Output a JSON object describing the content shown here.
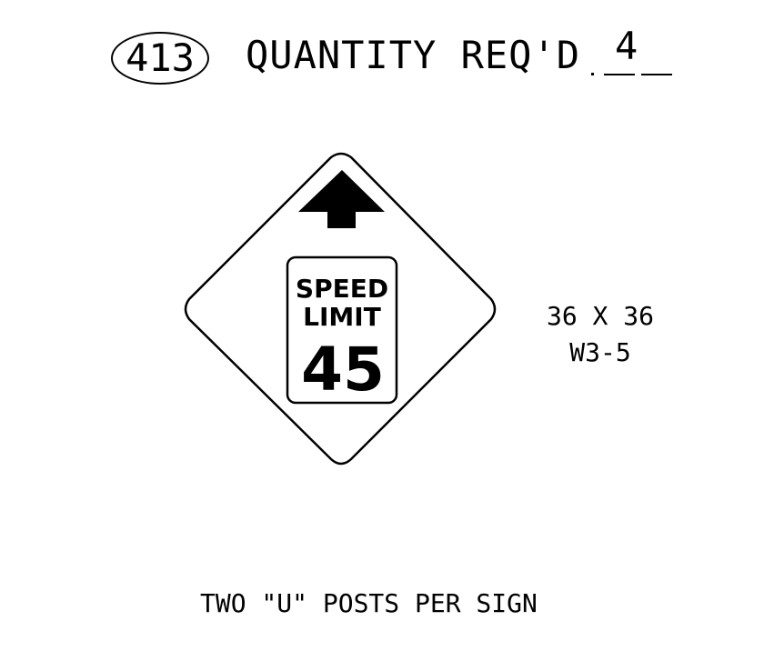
{
  "header": {
    "sign_id": "413",
    "quantity_label": "QUANTITY REQ'D",
    "quantity_value": "4"
  },
  "sign": {
    "shape": "diamond",
    "arrow": "up-arrow-icon",
    "panel_line1": "SPEED",
    "panel_line2": "LIMIT",
    "panel_number": "45",
    "border_color": "#000000",
    "background_color": "#ffffff"
  },
  "specs": {
    "size": "36 X 36",
    "code": "W3-5"
  },
  "note": {
    "text": "TWO \"U\" POSTS PER SIGN"
  }
}
